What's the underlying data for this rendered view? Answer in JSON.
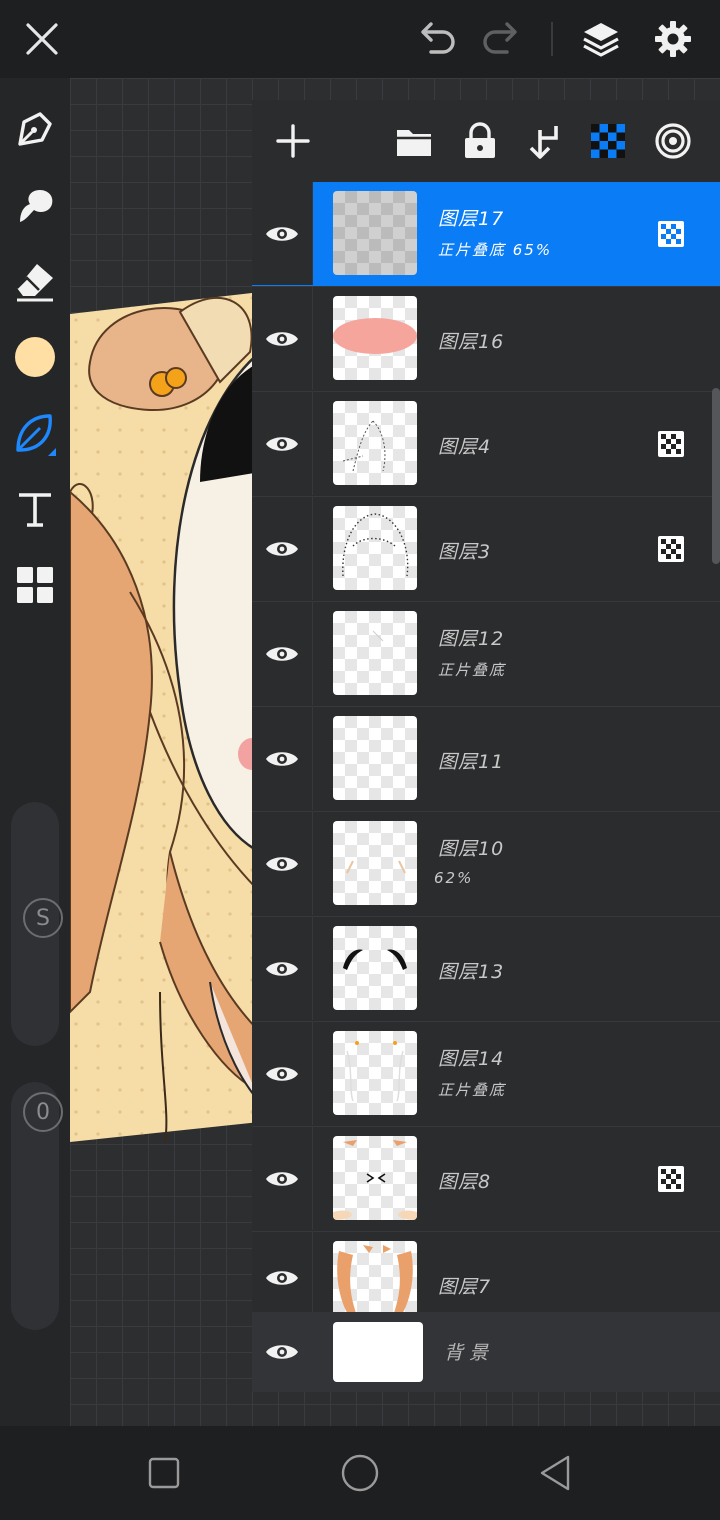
{
  "app": {
    "icons": {
      "close": "close-icon",
      "undo": "undo-icon",
      "redo": "redo-icon",
      "layers": "layers-icon",
      "settings": "gear-icon"
    }
  },
  "tools": {
    "items": [
      {
        "name": "pen-tool",
        "icon": "pen-nib-icon"
      },
      {
        "name": "smudge-tool",
        "icon": "smudge-icon"
      },
      {
        "name": "eraser-tool",
        "icon": "eraser-icon"
      },
      {
        "name": "color-picker",
        "icon": "color-swatch",
        "color": "#FFDFA3"
      },
      {
        "name": "selection-tool",
        "icon": "leaf-lasso-icon",
        "active": true,
        "color": "#1e88ff"
      },
      {
        "name": "text-tool",
        "icon": "text-T-icon"
      },
      {
        "name": "grid-tool",
        "icon": "grid-icon"
      }
    ],
    "size_badge": "S",
    "opacity_badge": "0"
  },
  "layer_panel": {
    "toolbar_icons": [
      "add-icon",
      "folder-icon",
      "lock-icon",
      "merge-down-icon",
      "reference-icon",
      "alpha-lock-icon"
    ],
    "accent_color": "#0a7cf5",
    "layers": [
      {
        "name": "图层17",
        "sub": "正片叠底 65%",
        "selected": true,
        "ref": true
      },
      {
        "name": "图层16",
        "sub": "",
        "ref": false
      },
      {
        "name": "图层4",
        "sub": "",
        "ref": true
      },
      {
        "name": "图层3",
        "sub": "",
        "ref": true
      },
      {
        "name": "图层12",
        "sub": "正片叠底",
        "ref": false
      },
      {
        "name": "图层11",
        "sub": "",
        "ref": false
      },
      {
        "name": "图层10",
        "sub": "62%",
        "ref": false
      },
      {
        "name": "图层13",
        "sub": "",
        "ref": false
      },
      {
        "name": "图层14",
        "sub": "正片叠底",
        "ref": false
      },
      {
        "name": "图层8",
        "sub": "",
        "ref": true
      },
      {
        "name": "图层7",
        "sub": "",
        "ref": false
      }
    ],
    "background_label": "背景"
  },
  "navbar": {
    "icons": [
      "recent-apps-icon",
      "home-icon",
      "back-icon"
    ]
  }
}
